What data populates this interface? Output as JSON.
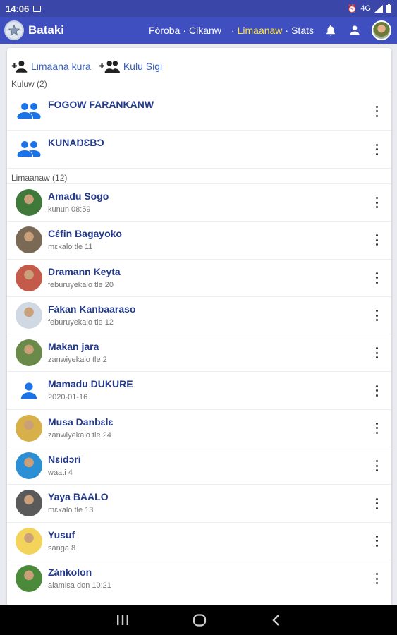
{
  "status_bar": {
    "time": "14:06",
    "signal_text": "4G"
  },
  "app": {
    "title": "Bataki"
  },
  "nav": {
    "items": [
      {
        "label": "Fòroba"
      },
      {
        "label": "Cikanw"
      },
      {
        "label": "Limaanaw",
        "active": true
      },
      {
        "label": "Stats"
      }
    ],
    "separator": "·"
  },
  "actions": {
    "new_contact": "Limaana kura",
    "new_group": "Kulu Sigi"
  },
  "groups_section": {
    "label": "Kuluw (2)"
  },
  "groups": [
    {
      "name": "FOGOW FARANKANW",
      "icon": "group-icon"
    },
    {
      "name": "KUNAŊƐBƆ",
      "icon": "group-icon"
    }
  ],
  "contacts_section": {
    "label": "Limaanaw (12)"
  },
  "contacts": [
    {
      "name": "Amadu Sogo",
      "sub": "kunun 08:59",
      "avatar_color": "#3f7a3a"
    },
    {
      "name": "Cɛ́fin Bagayoko",
      "sub": "mɛkalo tle 11",
      "avatar_color": "#7a6a55"
    },
    {
      "name": "Dramann Keyta",
      "sub": "feburuyekalo tle 20",
      "avatar_color": "#c45a4a"
    },
    {
      "name": "Fàkan Kanbaaraso",
      "sub": "feburuyekalo tle 12",
      "avatar_color": "#cfd8e3"
    },
    {
      "name": "Makan jara",
      "sub": "zanwiyekalo tle 2",
      "avatar_color": "#6a8a4a"
    },
    {
      "name": "Mamadu DUKURE",
      "sub": "2020-01-16",
      "avatar_color": "#1a73e8",
      "default_avatar": true
    },
    {
      "name": "Musa Danbɛlɛ",
      "sub": "zanwiyekalo tle 24",
      "avatar_color": "#d8b04a"
    },
    {
      "name": "Nɛidɔri",
      "sub": "waati 4",
      "avatar_color": "#2a8fd4"
    },
    {
      "name": "Yaya BAALO",
      "sub": "mɛkalo tle 13",
      "avatar_color": "#5a5a5a"
    },
    {
      "name": "Yusuf",
      "sub": "sanga 8",
      "avatar_color": "#f3d35a"
    },
    {
      "name": "Zànkolon",
      "sub": "alamisa don 10:21",
      "avatar_color": "#4a8a3a"
    }
  ],
  "colors": {
    "app_bar": "#3f4fbf",
    "active_tab": "#ffe23a",
    "name_text": "#233a8c",
    "link": "#3b62c2",
    "group_icon": "#1a73e8"
  }
}
